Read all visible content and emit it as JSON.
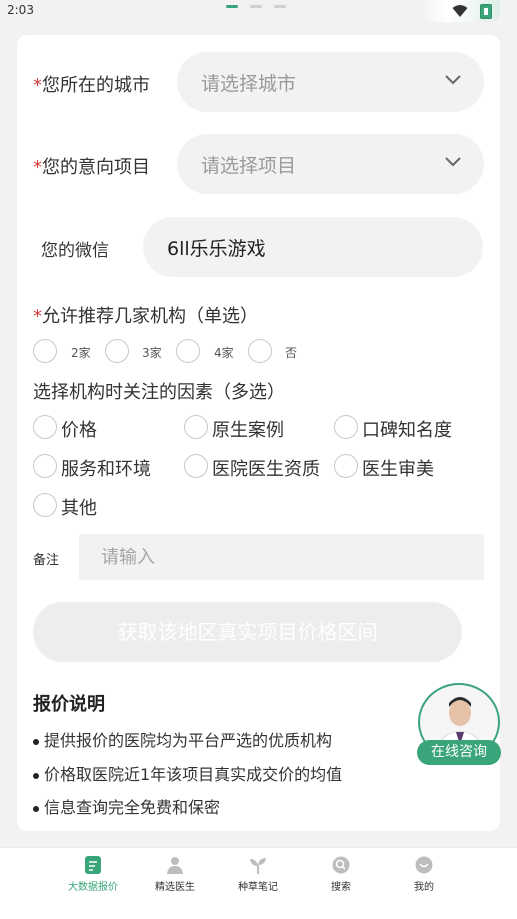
{
  "status_bar": {
    "time": "2:03"
  },
  "form": {
    "city": {
      "required_mark": "*",
      "label": "您所在的城市",
      "placeholder": "请选择城市"
    },
    "project": {
      "required_mark": "*",
      "label": "您的意向项目",
      "placeholder": "请选择项目"
    },
    "wechat": {
      "label": "您的微信",
      "value": "6ll乐乐游戏"
    },
    "institutions": {
      "required_mark": "*",
      "label": "允许推荐几家机构（单选）",
      "options": [
        "2家",
        "3家",
        "4家",
        "否"
      ]
    },
    "factors": {
      "label": "选择机构时关注的因素（多选）",
      "options": [
        "价格",
        "原生案例",
        "口碑知名度",
        "服务和环境",
        "医院医生资质",
        "医生审美",
        "其他"
      ]
    },
    "remark": {
      "label": "备注",
      "placeholder": "请输入"
    },
    "submit_label": "获取该地区真实项目价格区间"
  },
  "pricing_info": {
    "title": "报价说明",
    "items": [
      "提供报价的医院均为平台严选的优质机构",
      "价格取医院近1年该项目真实成交价的均值",
      "信息查询完全免费和保密"
    ]
  },
  "consult": {
    "label": "在线咨询"
  },
  "bottom_nav": {
    "active_index": 0,
    "items": [
      {
        "label": "大数据报价",
        "icon": "report-icon"
      },
      {
        "label": "精选医生",
        "icon": "doctor-icon"
      },
      {
        "label": "种草笔记",
        "icon": "sprout-icon"
      },
      {
        "label": "搜索",
        "icon": "search-icon"
      },
      {
        "label": "我的",
        "icon": "profile-icon"
      }
    ]
  },
  "colors": {
    "accent": "#3aa57a",
    "required": "#d23a3a",
    "input_bg": "#f2f2f2",
    "page_bg": "#f2f2f2"
  }
}
